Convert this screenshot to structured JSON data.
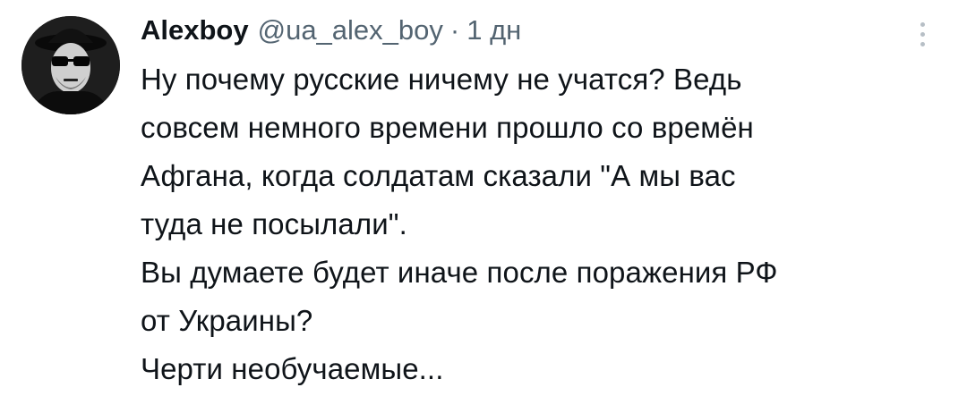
{
  "tweet": {
    "author": {
      "display_name": "Alexboy",
      "handle": "@ua_alex_boy",
      "avatar": "avatar"
    },
    "separator": "·",
    "time": "1 дн",
    "more_icon": "more-vertical-icon",
    "text_lines": [
      "Ну почему русские ничему не учатся? Ведь",
      "совсем немного времени прошло со времён",
      "Афгана, когда солдатам сказали \"А мы вас",
      "туда не посылали\".",
      "Вы думаете будет иначе после поражения РФ",
      "от Украины?",
      "Черти необучаемые..."
    ]
  },
  "colors": {
    "text": "#0f1419",
    "secondary": "#536471",
    "background": "#ffffff"
  }
}
